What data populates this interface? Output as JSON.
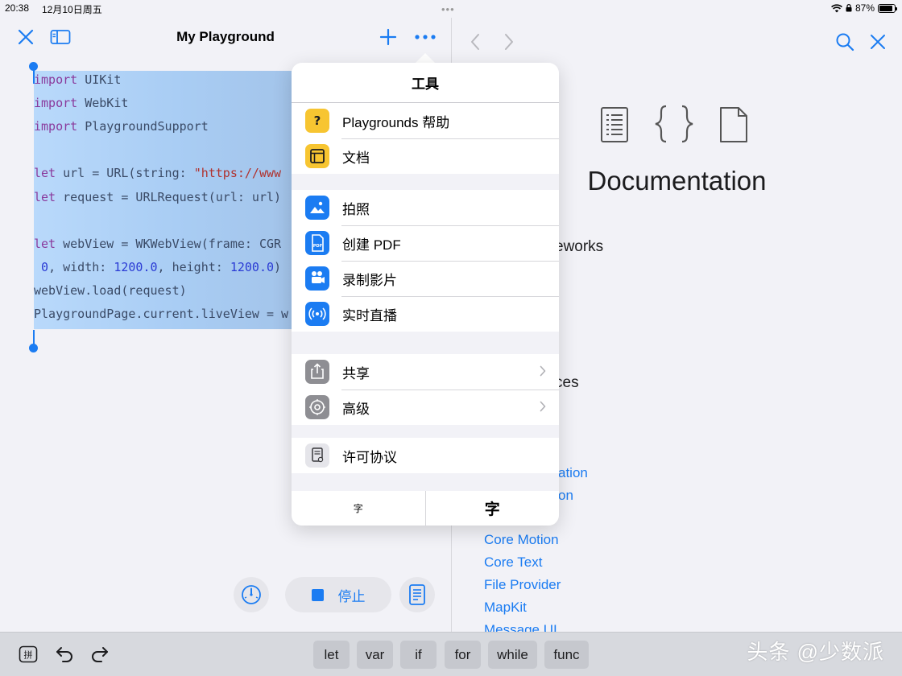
{
  "status_bar": {
    "time": "20:38",
    "date": "12月10日周五",
    "battery_percent": "87%",
    "battery_level": 0.87
  },
  "editor": {
    "title": "My Playground",
    "code_lines": [
      [
        {
          "t": "import",
          "c": "kw"
        },
        {
          "t": " UIKit",
          "c": ""
        }
      ],
      [
        {
          "t": "import",
          "c": "kw"
        },
        {
          "t": " WebKit",
          "c": ""
        }
      ],
      [
        {
          "t": "import",
          "c": "kw"
        },
        {
          "t": " PlaygroundSupport",
          "c": ""
        }
      ],
      [],
      [
        {
          "t": "let",
          "c": "kw"
        },
        {
          "t": " url = URL(string: ",
          "c": ""
        },
        {
          "t": "\"https://www",
          "c": "str"
        }
      ],
      [
        {
          "t": "let",
          "c": "kw"
        },
        {
          "t": " request = URLRequest(url: url)",
          "c": ""
        }
      ],
      [],
      [
        {
          "t": "let",
          "c": "kw"
        },
        {
          "t": " webView = WKWebView(frame: CGR",
          "c": ""
        }
      ],
      [
        {
          "t": " ",
          "c": ""
        },
        {
          "t": "0",
          "c": "num"
        },
        {
          "t": ", width: ",
          "c": ""
        },
        {
          "t": "1200.0",
          "c": "num"
        },
        {
          "t": ", height: ",
          "c": ""
        },
        {
          "t": "1200.0",
          "c": "num"
        },
        {
          "t": ")",
          "c": ""
        }
      ],
      [
        {
          "t": "webView.load(request)",
          "c": ""
        }
      ],
      [
        {
          "t": "PlaygroundPage.current.liveView = w",
          "c": ""
        }
      ]
    ],
    "stop_label": "停止"
  },
  "popover": {
    "title": "工具",
    "groups": [
      [
        {
          "id": "help",
          "label": "Playgrounds 帮助",
          "icon": "question-icon",
          "icon_glyph": "?",
          "color": "#f7c531"
        },
        {
          "id": "docs",
          "label": "文档",
          "icon": "document-panel-icon",
          "icon_glyph": "",
          "color": "#f7c531"
        }
      ],
      [
        {
          "id": "photo",
          "label": "拍照",
          "icon": "photo-icon",
          "icon_glyph": "",
          "color": "#1b7cf2"
        },
        {
          "id": "pdf",
          "label": "创建 PDF",
          "icon": "pdf-icon",
          "icon_glyph": "",
          "color": "#1b7cf2"
        },
        {
          "id": "record",
          "label": "录制影片",
          "icon": "video-camera-icon",
          "icon_glyph": "",
          "color": "#1b7cf2"
        },
        {
          "id": "live",
          "label": "实时直播",
          "icon": "broadcast-icon",
          "icon_glyph": "",
          "color": "#1b7cf2"
        }
      ],
      [
        {
          "id": "share",
          "label": "共享",
          "icon": "share-icon",
          "icon_glyph": "",
          "color": "#8e8e93",
          "chevron": true
        },
        {
          "id": "advanced",
          "label": "高级",
          "icon": "gear-icon",
          "icon_glyph": "",
          "color": "#8e8e93",
          "chevron": true
        }
      ],
      [
        {
          "id": "license",
          "label": "许可协议",
          "icon": "license-icon",
          "icon_glyph": "",
          "color": "#e5e5ea"
        }
      ]
    ],
    "font_small": "字",
    "font_large": "字"
  },
  "docs": {
    "title": "Documentation",
    "sections": [
      "eworks",
      "ces"
    ],
    "fragments": [
      "ation",
      "on"
    ],
    "links": [
      "Core Motion",
      "Core Text",
      "File Provider",
      "MapKit",
      "Message UI"
    ]
  },
  "keyboard": {
    "keys": [
      "let",
      "var",
      "if",
      "for",
      "while",
      "func"
    ],
    "watermark": "头条 @少数派"
  },
  "colors": {
    "accent": "#1b7cf2",
    "keyword": "#9b2393",
    "string": "#c41a16",
    "number": "#1c00cf"
  }
}
